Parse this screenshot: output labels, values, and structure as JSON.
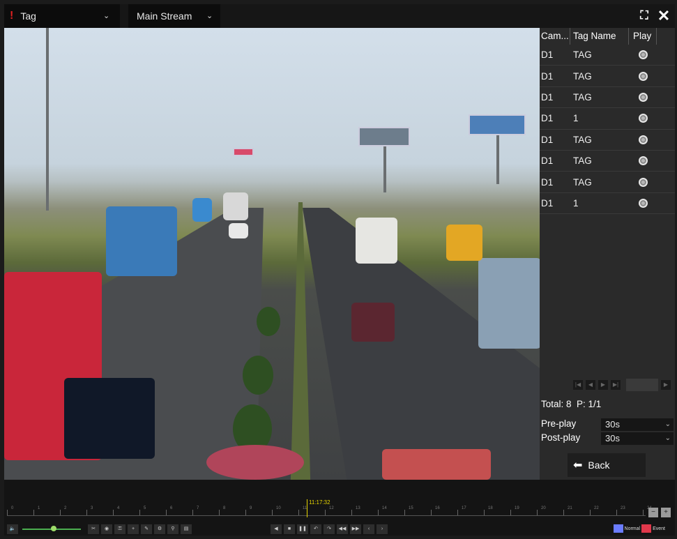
{
  "topbar": {
    "mode_label": "Tag",
    "stream_label": "Main Stream",
    "icons": [
      "fullscreen-icon",
      "close-icon"
    ]
  },
  "table": {
    "headers": [
      "Cam...",
      "Tag Name",
      "Play"
    ],
    "rows": [
      {
        "cam": "D1",
        "tag": "TAG"
      },
      {
        "cam": "D1",
        "tag": "TAG"
      },
      {
        "cam": "D1",
        "tag": "TAG"
      },
      {
        "cam": "D1",
        "tag": "1"
      },
      {
        "cam": "D1",
        "tag": "TAG"
      },
      {
        "cam": "D1",
        "tag": "TAG"
      },
      {
        "cam": "D1",
        "tag": "TAG"
      },
      {
        "cam": "D1",
        "tag": "1"
      }
    ]
  },
  "panel": {
    "total": "Total: 8",
    "page": "P: 1/1",
    "preplay_label": "Pre-play",
    "preplay_value": "30s",
    "postplay_label": "Post-play",
    "postplay_value": "30s",
    "back_label": "Back"
  },
  "timeline": {
    "current_time": "11:17:32",
    "hours": [
      "0",
      "1",
      "2",
      "3",
      "4",
      "5",
      "6",
      "7",
      "8",
      "9",
      "10",
      "11",
      "12",
      "13",
      "14",
      "15",
      "16",
      "17",
      "18",
      "19",
      "20",
      "21",
      "22",
      "23",
      "24"
    ],
    "legend_normal": "Normal",
    "legend_event": "Event",
    "colors": {
      "normal": "#6b7cff",
      "event": "#e0384b",
      "cursor": "#e6d400"
    }
  }
}
